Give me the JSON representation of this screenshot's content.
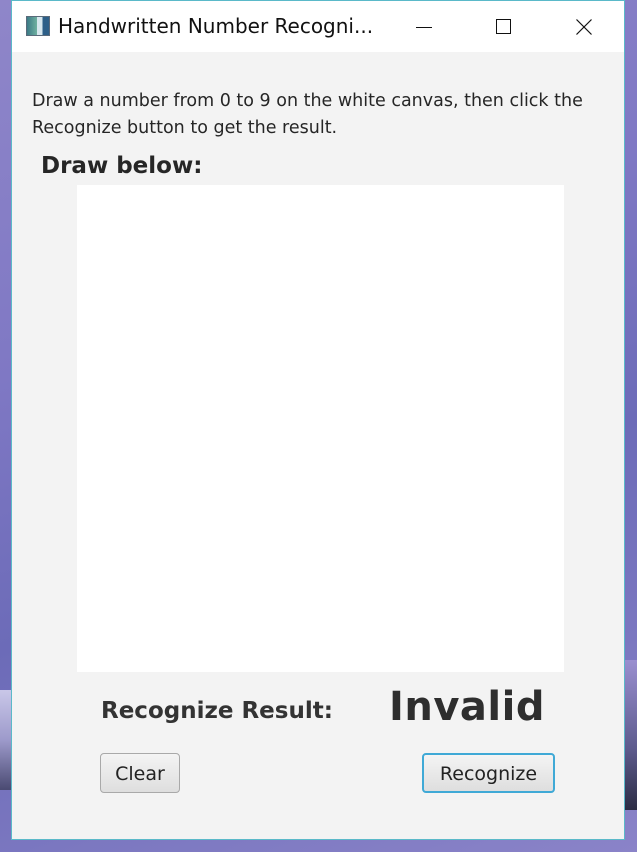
{
  "window": {
    "title": "Handwritten Number Recogni..."
  },
  "icons": {
    "app": "app-icon",
    "minimize": "minimize-icon",
    "maximize": "maximize-icon",
    "close": "close-icon"
  },
  "main": {
    "instructions": "Draw a number from 0 to 9 on the white canvas, then click the Recognize button to get the result.",
    "draw_label": "Draw below:",
    "result_label": "Recognize Result:",
    "result_value": "Invalid"
  },
  "buttons": {
    "clear": "Clear",
    "recognize": "Recognize"
  },
  "colors": {
    "window_border": "#5ab9c9",
    "focus_ring": "#3fa9d6",
    "canvas": "#ffffff",
    "background": "#f3f3f3"
  }
}
